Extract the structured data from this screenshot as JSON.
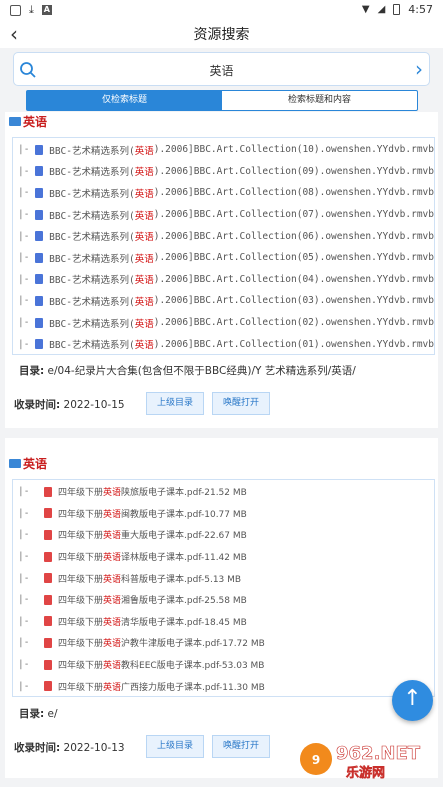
{
  "status_bar": {
    "time": "4:57"
  },
  "header": {
    "title": "资源搜索"
  },
  "search": {
    "query": "英语"
  },
  "tabs": [
    {
      "label": "仅检索标题",
      "active": true
    },
    {
      "label": "检索标题和内容",
      "active": false
    }
  ],
  "results": [
    {
      "title": "英语",
      "items": [
        {
          "prefix": "|-",
          "pre": "BBC-艺术精选系列(",
          "hl": "英语",
          "post": ").2006]BBC.Art.Collection(10).owenshen.YYdvb.rmvb"
        },
        {
          "prefix": "|-",
          "pre": "BBC-艺术精选系列(",
          "hl": "英语",
          "post": ").2006]BBC.Art.Collection(09).owenshen.YYdvb.rmvb"
        },
        {
          "prefix": "|-",
          "pre": "BBC-艺术精选系列(",
          "hl": "英语",
          "post": ").2006]BBC.Art.Collection(08).owenshen.YYdvb.rmvb"
        },
        {
          "prefix": "|-",
          "pre": "BBC-艺术精选系列(",
          "hl": "英语",
          "post": ").2006]BBC.Art.Collection(07).owenshen.YYdvb.rmvb"
        },
        {
          "prefix": "|-",
          "pre": "BBC-艺术精选系列(",
          "hl": "英语",
          "post": ").2006]BBC.Art.Collection(06).owenshen.YYdvb.rmvb"
        },
        {
          "prefix": "|-",
          "pre": "BBC-艺术精选系列(",
          "hl": "英语",
          "post": ").2006]BBC.Art.Collection(05).owenshen.YYdvb.rmvb"
        },
        {
          "prefix": "|-",
          "pre": "BBC-艺术精选系列(",
          "hl": "英语",
          "post": ").2006]BBC.Art.Collection(04).owenshen.YYdvb.rmvb"
        },
        {
          "prefix": "|-",
          "pre": "BBC-艺术精选系列(",
          "hl": "英语",
          "post": ").2006]BBC.Art.Collection(03).owenshen.YYdvb.rmvb"
        },
        {
          "prefix": "|-",
          "pre": "BBC-艺术精选系列(",
          "hl": "英语",
          "post": ").2006]BBC.Art.Collection(02).owenshen.YYdvb.rmvb"
        },
        {
          "prefix": "|-",
          "pre": "BBC-艺术精选系列(",
          "hl": "英语",
          "post": ").2006]BBC.Art.Collection(01).owenshen.YYdvb.rmvb"
        }
      ],
      "dir_label": "目录:",
      "dir_value": "e/04-纪录片大合集(包含但不限于BBC经典)/Y 艺术精选系列/英语/",
      "date_label": "收录时间:",
      "date": "2022-10-15",
      "btn_parent": "上级目录",
      "btn_open": "唤醒打开"
    },
    {
      "title": "英语",
      "items": [
        {
          "prefix": "|-",
          "pre": "四年级下册",
          "hl": "英语",
          "post": "陕旅版电子课本.pdf-21.52 MB"
        },
        {
          "prefix": "|-",
          "pre": "四年级下册",
          "hl": "英语",
          "post": "闽教版电子课本.pdf-10.77 MB"
        },
        {
          "prefix": "|-",
          "pre": "四年级下册",
          "hl": "英语",
          "post": "重大版电子课本.pdf-22.67 MB"
        },
        {
          "prefix": "|-",
          "pre": "四年级下册",
          "hl": "英语",
          "post": "译林版电子课本.pdf-11.42 MB"
        },
        {
          "prefix": "|-",
          "pre": "四年级下册",
          "hl": "英语",
          "post": "科普版电子课本.pdf-5.13 MB"
        },
        {
          "prefix": "|-",
          "pre": "四年级下册",
          "hl": "英语",
          "post": "湘鲁版电子课本.pdf-25.58 MB"
        },
        {
          "prefix": "|-",
          "pre": "四年级下册",
          "hl": "英语",
          "post": "清华版电子课本.pdf-18.45 MB"
        },
        {
          "prefix": "|-",
          "pre": "四年级下册",
          "hl": "英语",
          "post": "沪教牛津版电子课本.pdf-17.72 MB"
        },
        {
          "prefix": "|-",
          "pre": "四年级下册",
          "hl": "英语",
          "post": "教科EEC版电子课本.pdf-53.03 MB"
        },
        {
          "prefix": "|-",
          "pre": "四年级下册",
          "hl": "英语",
          "post": "广西接力版电子课本.pdf-11.30 MB"
        }
      ],
      "dir_label": "目录:",
      "dir_value": "e/",
      "date_label": "收录时间:",
      "date": "2022-10-13",
      "btn_parent": "上级目录",
      "btn_open": "唤醒打开"
    }
  ],
  "fab_icon": "arrow-up-icon",
  "watermark": {
    "brand": "962.NET",
    "tagline": "乐游网"
  },
  "colors": {
    "accent": "#2a86d8",
    "highlight": "#d21010",
    "video_icon": "#4a74d8",
    "pdf_icon": "#e04545"
  }
}
